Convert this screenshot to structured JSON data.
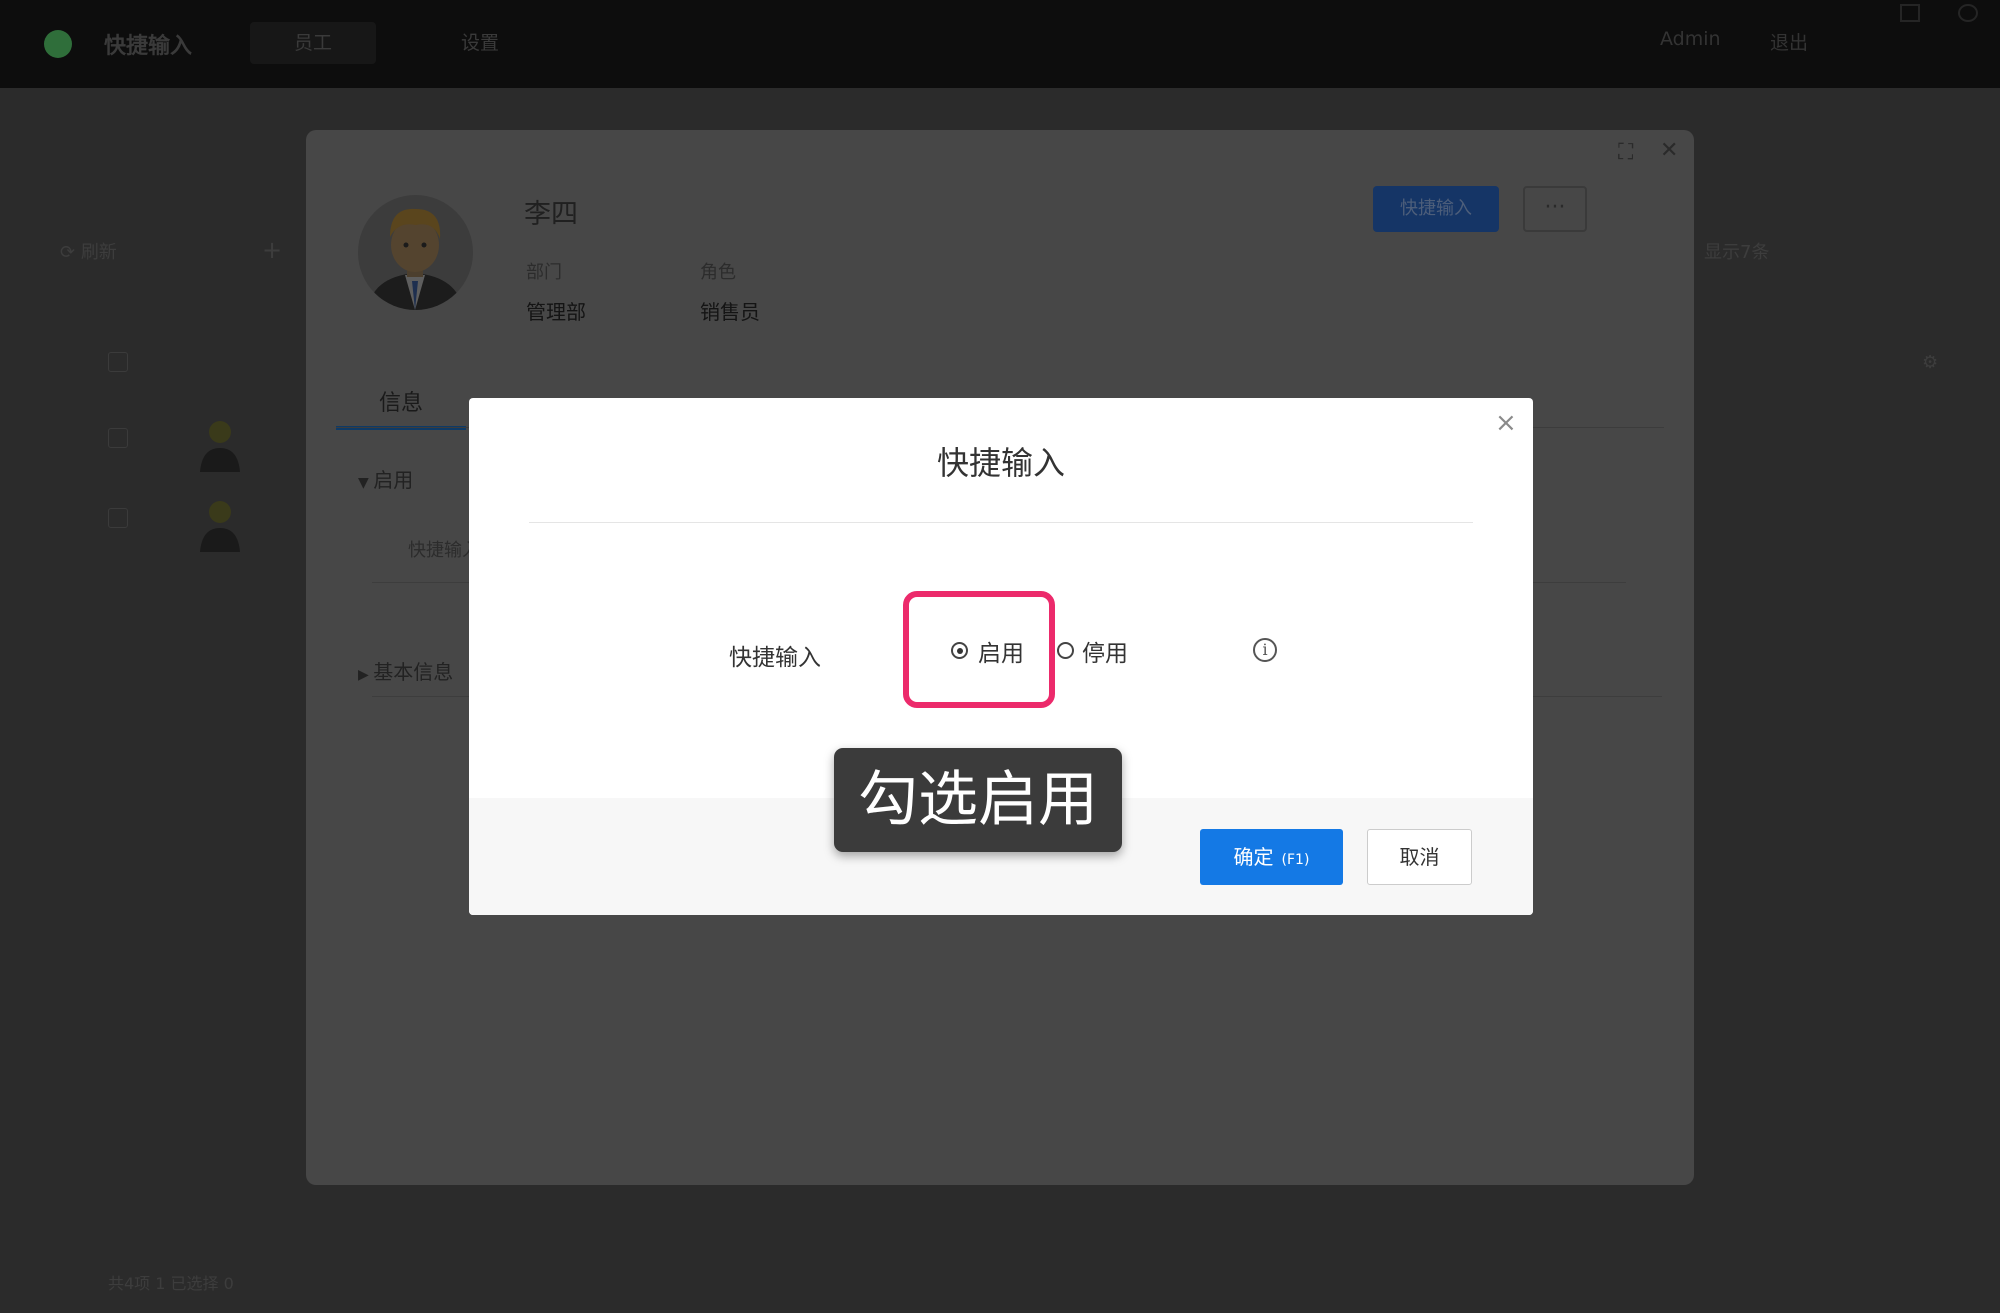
{
  "app": {
    "title": "快捷输入"
  },
  "topnav": {
    "tabs": [
      "员工",
      "设置"
    ],
    "user": "Admin",
    "logout": "退出"
  },
  "background": {
    "toolbar_left": "刷新",
    "toolbar_right": "显示7条",
    "footer": "共4项 1 已选择 0"
  },
  "panel": {
    "name": "李四",
    "fields": [
      {
        "label": "部门",
        "value": "管理部"
      },
      {
        "label": "角色",
        "value": "销售员"
      }
    ],
    "quick_input_button": "快捷输入",
    "more_button": "···",
    "tab": "信息",
    "section_enabled": "启用",
    "section_row": "快捷输入",
    "section_basic": "基本信息"
  },
  "modal": {
    "title": "快捷输入",
    "close": "×",
    "field_label": "快捷输入",
    "options": [
      "启用",
      "停用"
    ],
    "selected": "启用",
    "ok_label": "确定",
    "ok_hotkey": "(F1)",
    "cancel_label": "取消"
  },
  "tooltip": {
    "text": "勾选启用"
  },
  "colors": {
    "primary": "#1479e5",
    "highlight": "#ec2a6b",
    "tooltip_bg": "#3b3b3b"
  }
}
